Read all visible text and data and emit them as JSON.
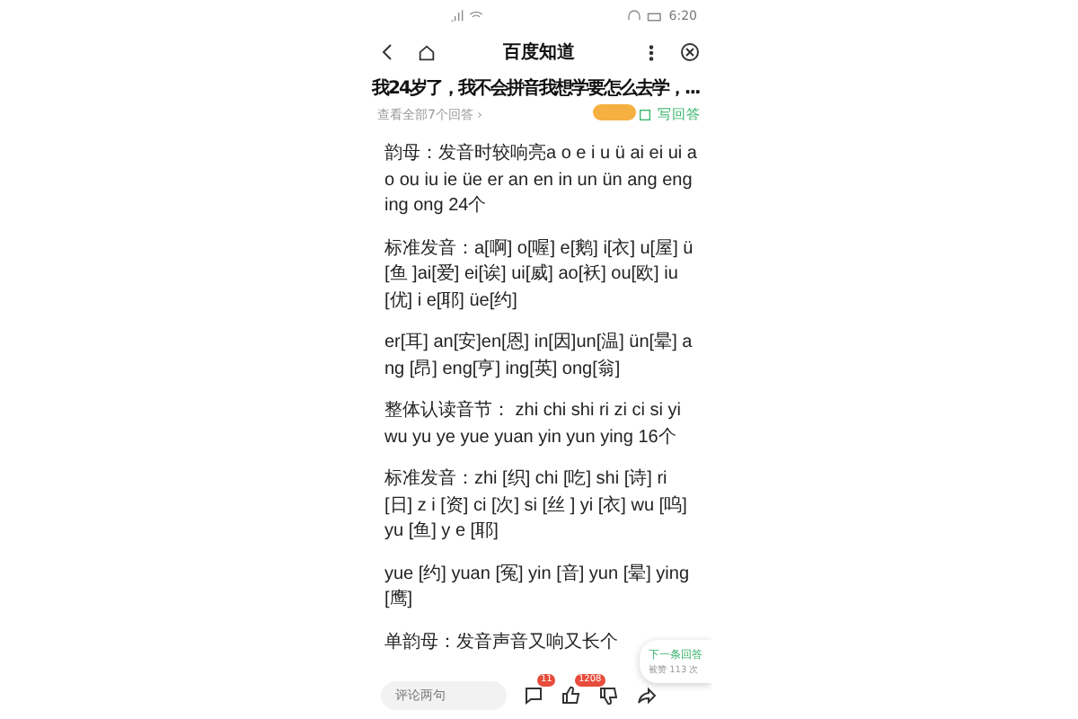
{
  "status_bar": {
    "time": "6:20"
  },
  "nav": {
    "title": "百度知道"
  },
  "question": {
    "title": "我24岁了，我不会拼音我想学要怎么去学，...",
    "all_answers": "查看全部7个回答 ›",
    "write_answer": "写回答"
  },
  "paragraphs": [
    "韵母：发音时较响亮a o e i u ü ai ei ui ao ou iu ie üe er an en in un ün ang eng ing ong 24个",
    "标准发音：a[啊] o[喔] e[鹅] i[衣] u[屋] ü [鱼 ]ai[爱] ei[诶] ui[威] ao[袄] ou[欧] iu[优] i e[耶] üe[约]",
    "er[耳] an[安]en[恩] in[因]un[温] ün[晕] ang [昂] eng[亨] ing[英] ong[翁]",
    "整体认读音节： zhi chi shi ri zi ci si yi wu yu ye yue yuan yin yun ying 16个",
    "标准发音：zhi [织] chi [吃] shi [诗] ri [日] z i [资] ci [次] si [丝 ] yi [衣] wu [呜] yu [鱼] y e [耶]",
    "yue [约] yuan [冤] yin [音] yun [晕] ying [鹰]",
    "单韵母：发音声音又响又长个"
  ],
  "next_answer": {
    "label": "下一条回答",
    "likes": "被赞 113 次"
  },
  "bottom_bar": {
    "comment_placeholder": "评论两句",
    "comment_count": "11",
    "like_count": "1208"
  }
}
